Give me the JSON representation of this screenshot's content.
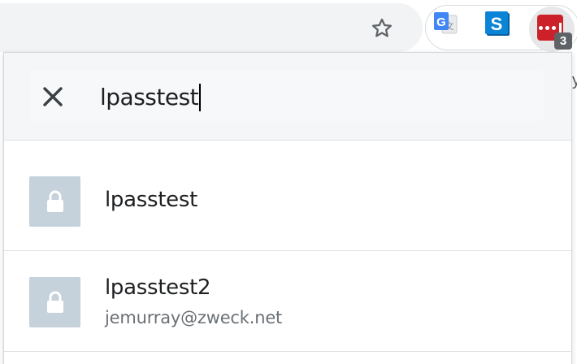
{
  "toolbar": {
    "bookmark_icon": "star-outline-icon",
    "extensions": [
      {
        "name": "google-translate",
        "icon": "translate-icon"
      },
      {
        "name": "s-extension",
        "icon": "s-icon"
      },
      {
        "name": "lastpass",
        "icon": "lastpass-icon",
        "badge": "3"
      }
    ],
    "background_text": "y"
  },
  "popup": {
    "search": {
      "value": "lpasstest",
      "close_icon": "close-icon"
    },
    "results": [
      {
        "title": "lpasstest",
        "subtitle": "",
        "icon": "lock-icon"
      },
      {
        "title": "lpasstest2",
        "subtitle": "jemurray@zweck.net",
        "icon": "lock-icon"
      }
    ]
  },
  "colors": {
    "lastpass_red": "#cc2128",
    "lock_tile": "#c5d1db",
    "badge_bg": "#5f6368"
  }
}
